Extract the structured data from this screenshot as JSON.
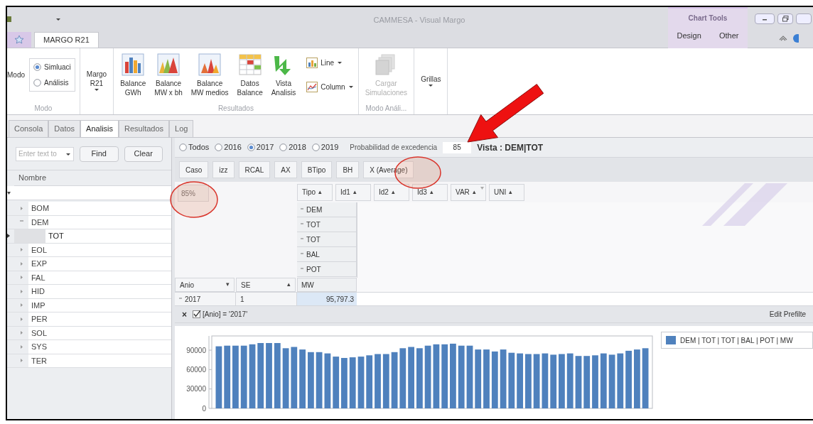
{
  "window": {
    "title": "CAMMESA - Visual Margo"
  },
  "ribbon_tabs": [
    {
      "label": "MARGO R21",
      "selected": true
    }
  ],
  "contextual_tabs": {
    "label": "Chart Tools",
    "tabs": [
      {
        "label": "Design",
        "selected": false
      },
      {
        "label": "Other",
        "selected": false
      }
    ]
  },
  "ribbon_groups": [
    {
      "label": "Modo",
      "items": [
        {
          "kind": "caption",
          "label": "Modo"
        },
        {
          "kind": "radio",
          "label": "Simluaci",
          "selected": true
        },
        {
          "kind": "radio",
          "label": "Análisis",
          "selected": false
        }
      ]
    },
    {
      "items": [
        {
          "kind": "menu",
          "label": "Margo\nR21",
          "disabled": false
        }
      ]
    },
    {
      "label": "Resultados",
      "items": [
        {
          "kind": "bars",
          "label": "Balance\nGWh",
          "disabled": false
        },
        {
          "kind": "peaks",
          "label": "Balance\nMW x bh",
          "disabled": false
        },
        {
          "kind": "cones",
          "label": "Balance\nMW medios",
          "disabled": false
        },
        {
          "kind": "grid",
          "label": "Datos\nBalance",
          "disabled": false
        },
        {
          "kind": "arrow",
          "label": "Vista\nAnalisis",
          "disabled": false
        },
        {
          "kind": "small",
          "label": "Line",
          "disabled": false
        },
        {
          "kind": "small",
          "label": "Column",
          "disabled": false
        }
      ]
    },
    {
      "label": "Modo Análi...",
      "items": [
        {
          "kind": "stack",
          "label": "Cargar\nSimulaciones",
          "disabled": true
        }
      ]
    },
    {
      "items": [
        {
          "kind": "menu",
          "label": "Grillas",
          "disabled": false
        }
      ]
    }
  ],
  "panel_tabs": [
    {
      "label": "Consola",
      "selected": false
    },
    {
      "label": "Datos",
      "selected": false
    },
    {
      "label": "Analisis",
      "selected": true
    },
    {
      "label": "Resultados",
      "selected": false
    },
    {
      "label": "Log",
      "selected": false
    }
  ],
  "left_panel": {
    "search": {
      "placeholder": "Enter text to"
    },
    "buttons": [
      "Find",
      "Clear"
    ],
    "column": "Nombre",
    "nodes": [
      {
        "label": "BOM",
        "expanded": false,
        "selected": false
      },
      {
        "label": "DEM",
        "expanded": true,
        "selected": false,
        "children": [
          {
            "label": "TOT",
            "selected": true
          }
        ]
      },
      {
        "label": "EOL",
        "expanded": false,
        "selected": false
      },
      {
        "label": "EXP",
        "expanded": false,
        "selected": false
      },
      {
        "label": "FAL",
        "expanded": false,
        "selected": false
      },
      {
        "label": "HID",
        "expanded": false,
        "selected": false
      },
      {
        "label": "IMP",
        "expanded": false,
        "selected": false
      },
      {
        "label": "PER",
        "expanded": false,
        "selected": false
      },
      {
        "label": "SOL",
        "expanded": false,
        "selected": false
      },
      {
        "label": "SYS",
        "expanded": false,
        "selected": false
      },
      {
        "label": "TER",
        "expanded": false,
        "selected": false
      }
    ]
  },
  "year_filter": [
    {
      "label": "Todos",
      "selected": false
    },
    {
      "label": "2016",
      "selected": false
    },
    {
      "label": "2017",
      "selected": true
    },
    {
      "label": "2018",
      "selected": false
    },
    {
      "label": "2019",
      "selected": false
    }
  ],
  "probability": {
    "label": "Probabilidad de excedencia",
    "value": "85"
  },
  "view_title": "Vista : DEM|TOT",
  "filter_fields": [
    "Caso",
    "izz",
    "RCAL",
    "AX",
    "BTipo",
    "BH",
    "X (Average)"
  ],
  "pivot": {
    "data_field": "85%",
    "column_fields": [
      {
        "label": "Tipo",
        "sort": "▴",
        "filtered": false
      },
      {
        "label": "Id1",
        "sort": "▴",
        "filtered": false
      },
      {
        "label": "Id2",
        "sort": "▴",
        "filtered": false
      },
      {
        "label": "Id3",
        "sort": "▴",
        "filtered": false
      },
      {
        "label": "VAR",
        "sort": "▴",
        "filtered": true
      },
      {
        "label": "UNI",
        "sort": "▴",
        "filtered": false
      }
    ],
    "column_values": [
      {
        "label": "DEM",
        "expanded": true
      },
      {
        "label": "TOT",
        "expanded": true
      },
      {
        "label": "TOT",
        "expanded": true
      },
      {
        "label": "BAL",
        "expanded": true
      },
      {
        "label": "POT",
        "expanded": true
      },
      {
        "label": "MW"
      }
    ],
    "row_fields": [
      {
        "label": "Anio",
        "sort": "▾"
      },
      {
        "label": "SE",
        "sort": "▴"
      }
    ],
    "rows": [
      {
        "anio": "2017",
        "expanded": true,
        "se": "1",
        "value": "95,797.3"
      }
    ]
  },
  "prefilter": {
    "close": "×",
    "enabled": true,
    "expression": "[Anio] = '2017'",
    "edit_label": "Edit Prefilte"
  },
  "chart": {
    "chart_data": {
      "type": "bar",
      "ylim": [
        0,
        112000
      ],
      "yticks": [
        0,
        30000,
        60000,
        90000
      ],
      "series": [
        {
          "name": "DEM | TOT | TOT | BAL | POT | MW",
          "color": "#4f81bd",
          "values": [
            96000,
            97000,
            97000,
            97000,
            99000,
            101000,
            101000,
            101000,
            93000,
            95000,
            91000,
            87000,
            87000,
            85000,
            80000,
            78000,
            79000,
            80000,
            82000,
            84000,
            84000,
            87000,
            93000,
            95000,
            93000,
            97000,
            99000,
            99000,
            100000,
            97000,
            97000,
            91000,
            91000,
            88000,
            91000,
            86000,
            85000,
            84000,
            84000,
            85000,
            83000,
            84000,
            85000,
            81000,
            81000,
            82000,
            85000,
            83000,
            85000,
            89000,
            91000,
            93000
          ]
        }
      ]
    }
  }
}
